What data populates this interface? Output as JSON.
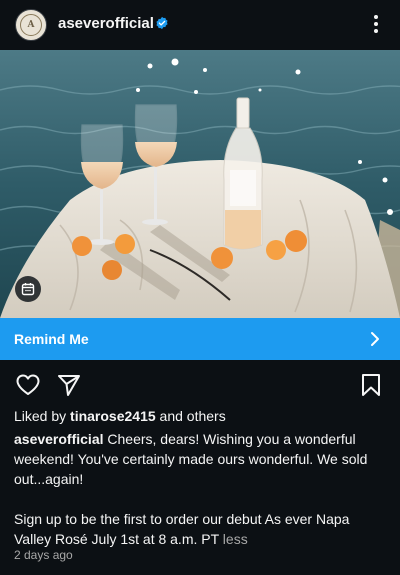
{
  "header": {
    "username": "aseverofficial",
    "verified_icon": "verified-badge-icon",
    "more_icon": "more-options-icon",
    "avatar_icon": "brand-seal-logo"
  },
  "post": {
    "image_alt_icon": "calendar-icon",
    "remind_label": "Remind Me",
    "remind_icon": "chevron-right-icon"
  },
  "actions": {
    "like_icon": "heart-icon",
    "share_icon": "paper-plane-icon",
    "save_icon": "bookmark-icon"
  },
  "likes": {
    "prefix": "Liked by",
    "user": "tinarose2415",
    "suffix": "and others"
  },
  "caption": {
    "username": "aseverofficial",
    "text": "Cheers, dears! Wishing you a wonderful weekend! You've certainly made ours wonderful. We sold out...again!",
    "text2": "Sign up to be the first to order our debut As ever Napa Valley Rosé July 1st at 8 a.m. PT",
    "less": "less"
  },
  "timestamp": "2 days ago",
  "colors": {
    "background": "#0c1014",
    "accent": "#1d9bf0",
    "text": "#f5f5f5",
    "muted": "#a8a8a8"
  }
}
